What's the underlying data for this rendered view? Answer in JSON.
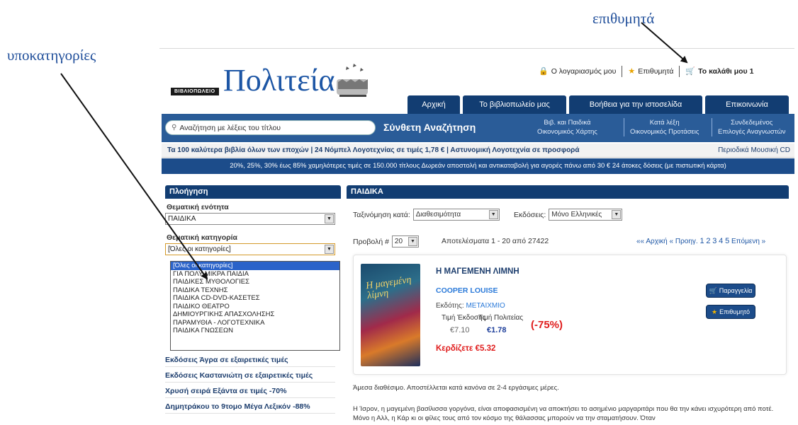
{
  "annotations": {
    "subcategories": "υποκατηγορίες",
    "wishlist": "επιθυμητά"
  },
  "logo": {
    "small_text": "ΒΙΒΛΙΟΠΩΛΕΙΟ",
    "name": "Πολιτεία"
  },
  "toplinks": {
    "account": "Ο λογαριασμός μου",
    "wishlist": "Επιθυμητά",
    "cart": "Το καλάθι μου 1"
  },
  "tabs": [
    "Αρχική",
    "Το βιβλιοπωλείο μας",
    "Βοήθεια για την ιστοσελίδα",
    "Επικοινωνία"
  ],
  "search": {
    "placeholder": "Αναζήτηση με λέξεις του τίτλου",
    "advanced": "Σύνθετη Αναζήτηση",
    "links": [
      {
        "line1": "Βιβ. και Παιδικά",
        "line2": "Οικονομικός Χάρτης"
      },
      {
        "line1": "Κατά λέξη",
        "line2": "Οικονομικός Προτάσεις"
      },
      {
        "line1": "Συνδεδεμένος",
        "line2": "Επιλογές Αναγνωστών"
      }
    ]
  },
  "promo1": {
    "left": "Τα 100 καλύτερα βιβλία όλων των εποχών | 24 Νόμπελ Λογοτεχνίας σε τιμές 1,78 € | Αστυνομική Λογοτεχνία σε προσφορά",
    "right": "Περιοδικά  Μουσική CD"
  },
  "promo2": "20%, 25%, 30% έως 85% χαμηλότερες τιμές σε 150.000 τίτλους   Δωρεάν αποστολή και αντικαταβολή για αγορές πάνω από 30 €   24 άτοκες δόσεις (με πιστωτική κάρτα)",
  "sidebar": {
    "header": "Πλοήγηση",
    "section_label": "Θεματική ενότητα",
    "section_value": "ΠΑΙΔΙΚΑ",
    "category_label": "Θεματική κατηγορία",
    "category_value": "[Όλες οι κατηγορίες]",
    "dropdown_options": [
      "[Όλες οι κατηγορίες]",
      "ΓΙΑ ΠΟΛΥ ΜΙΚΡΑ ΠΑΙΔΙΑ",
      "ΠΑΙΔΙΚΕΣ ΜΥΘΟΛΟΓΙΕΣ",
      "ΠΑΙΔΙΚΑ ΤΕΧΝΗΣ",
      "ΠΑΙΔΙΚΑ CD-DVD-ΚΑΣΕΤΕΣ",
      "ΠΑΙΔΙΚΟ ΘΕΑΤΡΟ",
      "ΔΗΜΙΟΥΡΓΙΚΗΣ ΑΠΑΣΧΟΛΗΣΗΣ",
      "ΠΑΡΑΜΥΘΙΑ - ΛΟΓΟΤΕΧΝΙΚΑ",
      "ΠΑΙΔΙΚΑ ΓΝΩΣΕΩΝ"
    ],
    "links": [
      "Εκδόσεις Άγρα σε εξαιρετικές τιμές",
      "Εκδόσεις Καστανιώτη σε εξαιρετικές τιμές",
      "Χρυσή σειρά Εξάντα σε τιμές -70%",
      "Δημητράκου το 9τομο Μέγα Λεξικόν -88%"
    ]
  },
  "main": {
    "header": "ΠΑΙΔΙΚΑ",
    "sort_label": "Ταξινόμηση κατά:",
    "sort_value": "Διαθεσιμότητα",
    "editions_label": "Εκδόσεις:",
    "editions_value": "Μόνο Ελληνικές",
    "show_label": "Προβολή #",
    "show_value": "20",
    "results": "Αποτελέσματα 1 - 20 από 27422",
    "paging_prefix": "«« Αρχική « Προηγ.",
    "pages": [
      "1",
      "2",
      "3",
      "4",
      "5"
    ],
    "paging_next": "Επόμενη »"
  },
  "product": {
    "cover_text": "Η μαγεμένη λίμνη",
    "title": "Η ΜΑΓΕΜΕΝΗ ΛΙΜΝΗ",
    "author": "COOPER LOUISE",
    "publisher_label": "Εκδότης:",
    "publisher": "ΜΕΤΑΙΧΜΙΟ",
    "price_label_1": "Τιμή Έκδοσης",
    "price_label_2": "Τιμή Πολιτείας",
    "price_1": "€7.10",
    "price_2": "€1.78",
    "discount": "(-75%)",
    "save": "Κερδίζετε €5.32",
    "order_button": "Παραγγελία",
    "wish_button": "Επιθυμητό"
  },
  "availability": "Άμεσα διαθέσιμο. Αποστέλλεται κατά κανόνα σε 2-4 εργάσιμες μέρες.",
  "description": "Η Ίσρον, η μαγεμένη βασίλισσα γοργόνα, είναι αποφασισμένη να αποκτήσει το ασημένιο μαργαριτάρι που θα την κάνει ισχυρότερη από ποτέ. Μόνο η Αλλ, η Κάρ κι οι φίλες τους από τον κόσμο της θάλασσας μπορούν να την σταματήσουν. Όταν"
}
